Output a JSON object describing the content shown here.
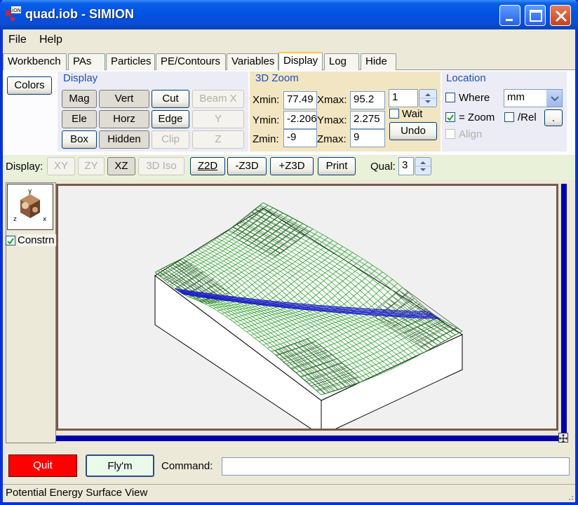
{
  "title": "quad.iob - SIMION",
  "app_icon_badge": "ION",
  "menu": [
    "File",
    "Help"
  ],
  "tabs": [
    "Workbench",
    "PAs",
    "Particles",
    "PE/Contours",
    "Variables",
    "Display",
    "Log",
    "Hide"
  ],
  "active_tab": "Display",
  "colors_button": "Colors",
  "display_group": {
    "title": "Display",
    "buttons": [
      "Mag",
      "Vert",
      "Cut",
      "Beam X",
      "Ele",
      "Horz",
      "Edge",
      "Y",
      "Box",
      "Hidden",
      "Clip",
      "Z"
    ]
  },
  "zoom3d": {
    "title": "3D Zoom",
    "xmin_label": "Xmin:",
    "xmin": "77.49",
    "xmax_label": "Xmax:",
    "xmax": "95.2",
    "ymin_label": "Ymin:",
    "ymin": "-2.206",
    "ymax_label": "Ymax:",
    "ymax": "2.275",
    "zmin_label": "Zmin:",
    "zmin": "-9",
    "zmax_label": "Zmax:",
    "zmax": "9",
    "step": "1",
    "wait_label": "Wait",
    "undo_label": "Undo"
  },
  "location": {
    "title": "Location",
    "where_label": "Where",
    "unit": "mm",
    "zoom_label": "= Zoom",
    "zoom_checked": true,
    "rel_label": "/Rel",
    "align_label": "Align",
    "dot_button": "."
  },
  "display_row": {
    "label": "Display:",
    "buttons": [
      "XY",
      "ZY",
      "XZ",
      "3D Iso",
      "Z2D",
      "-Z3D",
      "+Z3D",
      "Print"
    ],
    "qual_label": "Qual:",
    "qual": "3"
  },
  "side_panel": {
    "axis_labels": [
      "y",
      "z",
      "x"
    ],
    "constrain_label": "Constrn",
    "constrain_checked": true
  },
  "colors": {
    "mesh": "#1a9a1a",
    "beam": "#1c1cc8",
    "electrode": "#202020",
    "quit_bg": "#ff0000"
  },
  "bottom": {
    "quit_label": "Quit",
    "flym_label": "Fly'm",
    "command_label": "Command:",
    "command_value": ""
  },
  "status": "Potential Energy Surface View"
}
